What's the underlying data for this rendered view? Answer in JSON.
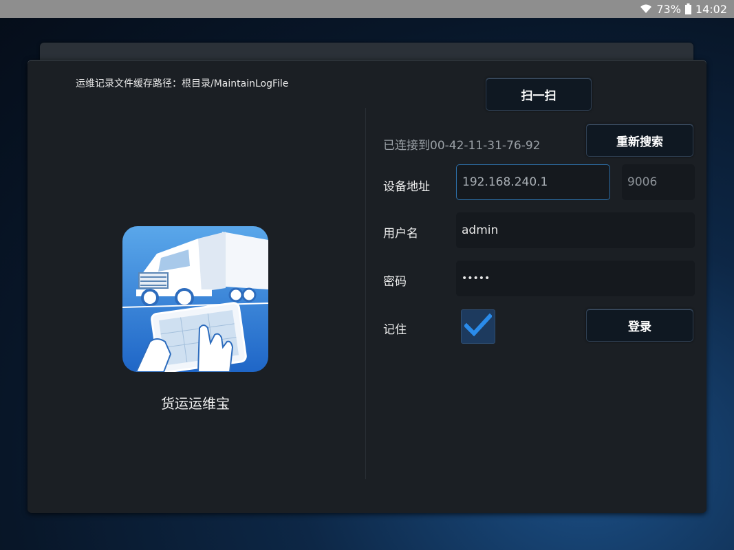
{
  "status_bar": {
    "battery_percent": "73%",
    "time": "14:02",
    "icons": [
      "wifi-icon",
      "battery-icon"
    ]
  },
  "panel": {
    "log_path_label": "运维记录文件缓存路径：根目录/MaintainLogFile"
  },
  "app": {
    "name": "货运运维宝",
    "icon": "truck-tablet-app-icon"
  },
  "connection": {
    "scan_button": "扫一扫",
    "status_text": "已连接到00-42-11-31-76-92",
    "research_button": "重新搜索"
  },
  "form": {
    "device_address_label": "设备地址",
    "device_address_value": "192.168.240.1",
    "port_value": "9006",
    "username_label": "用户名",
    "username_value": "admin",
    "password_label": "密码",
    "password_value": "•••••",
    "remember_label": "记住",
    "remember_checked": true,
    "login_button": "登录"
  },
  "colors": {
    "accent": "#2d6fa8",
    "panel_bg": "#1b1f24",
    "check": "#2a8bea"
  }
}
